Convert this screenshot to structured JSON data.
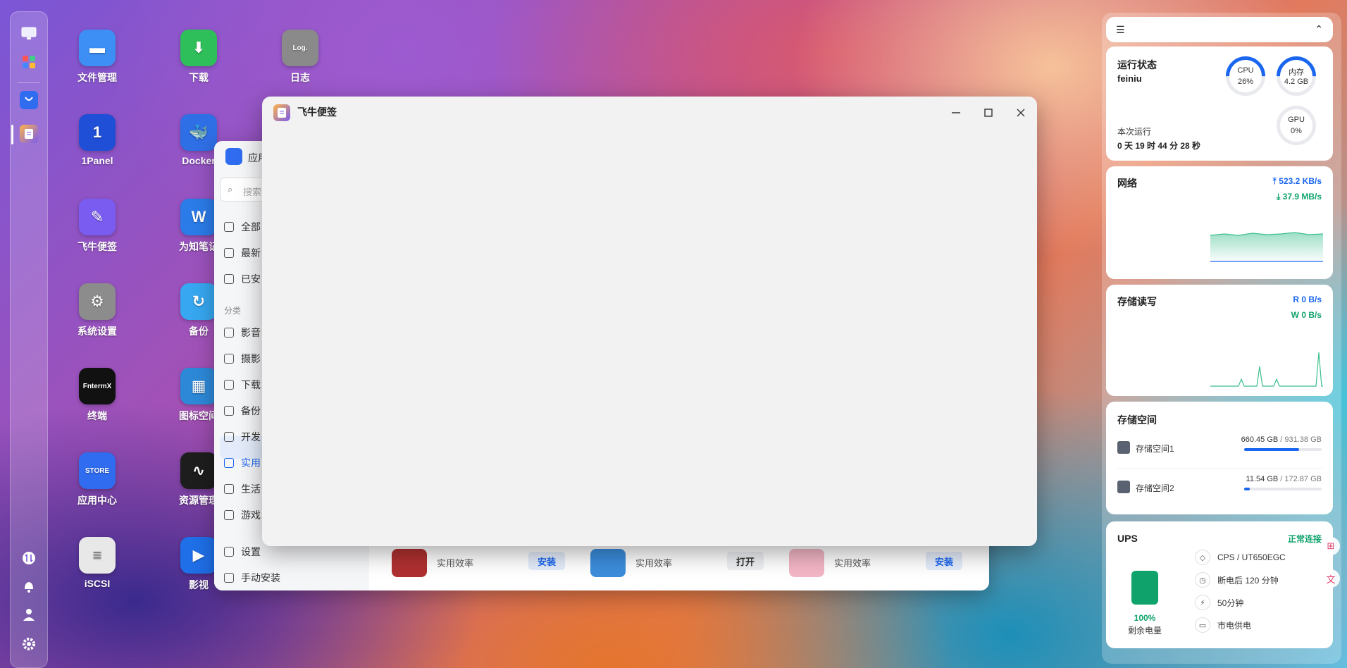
{
  "desktop": {
    "icons": [
      {
        "label": "文件管理",
        "glyph": "▬",
        "color": "#3d8ff5"
      },
      {
        "label": "下载",
        "glyph": "⬇",
        "color": "#2fbf5a"
      },
      {
        "label": "日志",
        "glyph": "Log.",
        "color": "#8a8a8a"
      },
      {
        "label": "1Panel",
        "glyph": "1",
        "color": "#1e4fd6"
      },
      {
        "label": "Docker",
        "glyph": "🐳",
        "color": "#2f6fe6"
      },
      {
        "label": "飞牛便签",
        "glyph": "✎",
        "color": "#7a5cf0"
      },
      {
        "label": "为知笔记",
        "glyph": "W",
        "color": "#2b7ce9"
      },
      {
        "label": "系统设置",
        "glyph": "⚙",
        "color": "#8c8c8c"
      },
      {
        "label": "备份",
        "glyph": "↻",
        "color": "#36a7f0"
      },
      {
        "label": "终端",
        "glyph": "FntermX",
        "color": "#111111"
      },
      {
        "label": "图标空间",
        "glyph": "▦",
        "color": "#2d89d8"
      },
      {
        "label": "应用中心",
        "glyph": "STORE",
        "color": "#2f6cf0"
      },
      {
        "label": "资源管理",
        "glyph": "∿",
        "color": "#1d1d1d"
      },
      {
        "label": "iSCSI",
        "glyph": "≡",
        "color": "#e8e8e8"
      },
      {
        "label": "影视",
        "glyph": "▶",
        "color": "#1f6fe8"
      }
    ]
  },
  "app_center": {
    "title_partial": "应用",
    "search_placeholder": "搜索",
    "nav": [
      "全部",
      "最新",
      "已安"
    ],
    "category_header": "分类",
    "categories": [
      "影音",
      "摄影",
      "下载",
      "备份",
      "开发",
      "实用",
      "生活",
      "游戏"
    ],
    "bottom": [
      "设置",
      "手动安装"
    ],
    "cards": [
      {
        "category": "实用效率",
        "button": "安装"
      },
      {
        "category": "实用效率",
        "button": "打开"
      },
      {
        "category": "实用效率",
        "button": "安装"
      }
    ]
  },
  "note_window": {
    "title": "飞牛便签",
    "minimize": "—",
    "maximize": "☐",
    "close": "✕"
  },
  "widgets": {
    "status": {
      "title": "运行状态",
      "host": "feiniu",
      "uptime_label": "本次运行",
      "uptime": "0 天 19 时 44 分 28 秒",
      "cpu_label": "CPU",
      "cpu_value": "26%",
      "mem_label": "内存",
      "mem_value": "4.2 GB",
      "gpu_label": "GPU",
      "gpu_value": "0%"
    },
    "network": {
      "title": "网络",
      "up": "523.2 KB/s",
      "down": "37.9 MB/s"
    },
    "disk_io": {
      "title": "存储读写",
      "read": "R  0 B/s",
      "write": "W  0 B/s"
    },
    "storage": {
      "title": "存储空间",
      "volumes": [
        {
          "name": "存储空间1",
          "used": "660.45 GB",
          "total": "/ 931.38 GB",
          "fraction": 0.71
        },
        {
          "name": "存储空间2",
          "used": "11.54 GB",
          "total": "/ 172.87 GB",
          "fraction": 0.07
        }
      ]
    },
    "ups": {
      "title": "UPS",
      "status": "正常连接",
      "percent": "100%",
      "percent_label": "剩余电量",
      "model": "CPS / UT650EGC",
      "shutdown": "断电后 120 分钟",
      "runtime": "50分钟",
      "power": "市电供电"
    }
  },
  "colors": {
    "accent": "#1a66f0",
    "green": "#0fa36b"
  }
}
